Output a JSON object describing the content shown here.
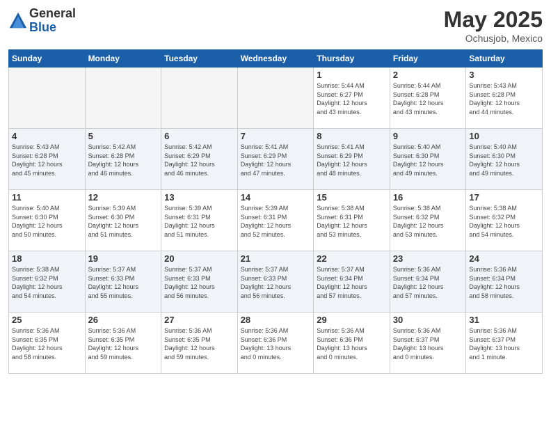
{
  "logo": {
    "general": "General",
    "blue": "Blue"
  },
  "title": {
    "month": "May 2025",
    "location": "Ochusjob, Mexico"
  },
  "days_of_week": [
    "Sunday",
    "Monday",
    "Tuesday",
    "Wednesday",
    "Thursday",
    "Friday",
    "Saturday"
  ],
  "weeks": [
    [
      {
        "day": "",
        "info": ""
      },
      {
        "day": "",
        "info": ""
      },
      {
        "day": "",
        "info": ""
      },
      {
        "day": "",
        "info": ""
      },
      {
        "day": "1",
        "info": "Sunrise: 5:44 AM\nSunset: 6:27 PM\nDaylight: 12 hours\nand 43 minutes."
      },
      {
        "day": "2",
        "info": "Sunrise: 5:44 AM\nSunset: 6:28 PM\nDaylight: 12 hours\nand 43 minutes."
      },
      {
        "day": "3",
        "info": "Sunrise: 5:43 AM\nSunset: 6:28 PM\nDaylight: 12 hours\nand 44 minutes."
      }
    ],
    [
      {
        "day": "4",
        "info": "Sunrise: 5:43 AM\nSunset: 6:28 PM\nDaylight: 12 hours\nand 45 minutes."
      },
      {
        "day": "5",
        "info": "Sunrise: 5:42 AM\nSunset: 6:28 PM\nDaylight: 12 hours\nand 46 minutes."
      },
      {
        "day": "6",
        "info": "Sunrise: 5:42 AM\nSunset: 6:29 PM\nDaylight: 12 hours\nand 46 minutes."
      },
      {
        "day": "7",
        "info": "Sunrise: 5:41 AM\nSunset: 6:29 PM\nDaylight: 12 hours\nand 47 minutes."
      },
      {
        "day": "8",
        "info": "Sunrise: 5:41 AM\nSunset: 6:29 PM\nDaylight: 12 hours\nand 48 minutes."
      },
      {
        "day": "9",
        "info": "Sunrise: 5:40 AM\nSunset: 6:30 PM\nDaylight: 12 hours\nand 49 minutes."
      },
      {
        "day": "10",
        "info": "Sunrise: 5:40 AM\nSunset: 6:30 PM\nDaylight: 12 hours\nand 49 minutes."
      }
    ],
    [
      {
        "day": "11",
        "info": "Sunrise: 5:40 AM\nSunset: 6:30 PM\nDaylight: 12 hours\nand 50 minutes."
      },
      {
        "day": "12",
        "info": "Sunrise: 5:39 AM\nSunset: 6:30 PM\nDaylight: 12 hours\nand 51 minutes."
      },
      {
        "day": "13",
        "info": "Sunrise: 5:39 AM\nSunset: 6:31 PM\nDaylight: 12 hours\nand 51 minutes."
      },
      {
        "day": "14",
        "info": "Sunrise: 5:39 AM\nSunset: 6:31 PM\nDaylight: 12 hours\nand 52 minutes."
      },
      {
        "day": "15",
        "info": "Sunrise: 5:38 AM\nSunset: 6:31 PM\nDaylight: 12 hours\nand 53 minutes."
      },
      {
        "day": "16",
        "info": "Sunrise: 5:38 AM\nSunset: 6:32 PM\nDaylight: 12 hours\nand 53 minutes."
      },
      {
        "day": "17",
        "info": "Sunrise: 5:38 AM\nSunset: 6:32 PM\nDaylight: 12 hours\nand 54 minutes."
      }
    ],
    [
      {
        "day": "18",
        "info": "Sunrise: 5:38 AM\nSunset: 6:32 PM\nDaylight: 12 hours\nand 54 minutes."
      },
      {
        "day": "19",
        "info": "Sunrise: 5:37 AM\nSunset: 6:33 PM\nDaylight: 12 hours\nand 55 minutes."
      },
      {
        "day": "20",
        "info": "Sunrise: 5:37 AM\nSunset: 6:33 PM\nDaylight: 12 hours\nand 56 minutes."
      },
      {
        "day": "21",
        "info": "Sunrise: 5:37 AM\nSunset: 6:33 PM\nDaylight: 12 hours\nand 56 minutes."
      },
      {
        "day": "22",
        "info": "Sunrise: 5:37 AM\nSunset: 6:34 PM\nDaylight: 12 hours\nand 57 minutes."
      },
      {
        "day": "23",
        "info": "Sunrise: 5:36 AM\nSunset: 6:34 PM\nDaylight: 12 hours\nand 57 minutes."
      },
      {
        "day": "24",
        "info": "Sunrise: 5:36 AM\nSunset: 6:34 PM\nDaylight: 12 hours\nand 58 minutes."
      }
    ],
    [
      {
        "day": "25",
        "info": "Sunrise: 5:36 AM\nSunset: 6:35 PM\nDaylight: 12 hours\nand 58 minutes."
      },
      {
        "day": "26",
        "info": "Sunrise: 5:36 AM\nSunset: 6:35 PM\nDaylight: 12 hours\nand 59 minutes."
      },
      {
        "day": "27",
        "info": "Sunrise: 5:36 AM\nSunset: 6:35 PM\nDaylight: 12 hours\nand 59 minutes."
      },
      {
        "day": "28",
        "info": "Sunrise: 5:36 AM\nSunset: 6:36 PM\nDaylight: 13 hours\nand 0 minutes."
      },
      {
        "day": "29",
        "info": "Sunrise: 5:36 AM\nSunset: 6:36 PM\nDaylight: 13 hours\nand 0 minutes."
      },
      {
        "day": "30",
        "info": "Sunrise: 5:36 AM\nSunset: 6:37 PM\nDaylight: 13 hours\nand 0 minutes."
      },
      {
        "day": "31",
        "info": "Sunrise: 5:36 AM\nSunset: 6:37 PM\nDaylight: 13 hours\nand 1 minute."
      }
    ]
  ]
}
